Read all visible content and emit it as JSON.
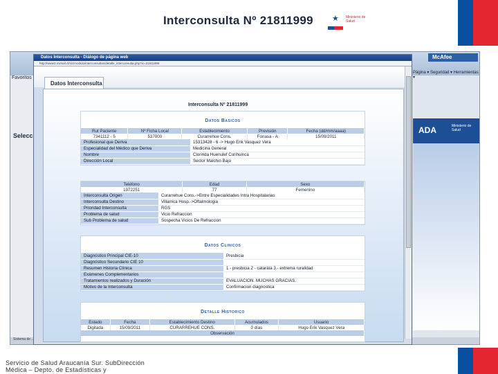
{
  "colors": {
    "flag_blue": "#0a4ea0",
    "flag_red": "#e3262f",
    "header_accent": "#2d5aa3",
    "label_cell": "#bfd2ea"
  },
  "background_window": {
    "toolbar_label": "Favoritos",
    "selector_label": "Selecc",
    "mcafee_label": "McAfee",
    "menu_label": "Página ▾  Seguridad ▾  Herramientas ▾",
    "banner_text": "ADA",
    "banner_sub": "Ministerio de Salud",
    "status_label": "Sistema de ..."
  },
  "dialog": {
    "title": "Datos Interconsulta - Diálogo de página web",
    "address": "http://www3.minsal.cl/sic/modulo/interconsultas/detalle_interconsulta.php?ic=21811999",
    "heading": "Interconsulta Nº 21811999",
    "logo_icon": "chile-government-star-icon",
    "logo_text": "Ministerio de Salud",
    "tab_label": "Datos Interconsulta",
    "form_title": "Interconsulta Nº 21811999"
  },
  "datos_basicos": {
    "title": "Datos Basicos",
    "headers": [
      "Rut Paciente",
      "Nº Ficha Local",
      "Establecimiento",
      "Previsión",
      "Fecha (dd/mm/aaaa)"
    ],
    "row": [
      "7341112 - 5",
      "537000",
      "Curarrehue Cons.",
      "Fonasa - A",
      "15/09/2011"
    ],
    "fields": [
      {
        "label": "Profesional que Deriva",
        "value": "15313428 - 6 -> Hugo Erik Vasquez Vera"
      },
      {
        "label": "Especialidad del Médico que Deriva",
        "value": "Medicina General"
      },
      {
        "label": "Nombre",
        "value": "Clorinda Huenulef Curihuinca"
      },
      {
        "label": "Dirección Local",
        "value": "Sector Malchin Bajo"
      }
    ]
  },
  "datos_paciente": {
    "headers": [
      "Teléfono",
      "Edad",
      "Sexo"
    ],
    "row": [
      "1972251",
      "77",
      "Femenino"
    ],
    "fields": [
      {
        "label": "Interconsulta Origen",
        "value": "Curarrehue Cons.->Entre Especialidades Intra Hospitalarias"
      },
      {
        "label": "Interconsulta Destino",
        "value": "Villarrica Hosp.->Oftalmologia"
      },
      {
        "label": "Prioridad Interconsulta",
        "value": "RGS"
      },
      {
        "label": "Problema de salud",
        "value": "Vicio Refraccion"
      },
      {
        "label": "Sub Problema de salud",
        "value": "Sospecha Vicios De Refraccion"
      }
    ]
  },
  "datos_clinicos": {
    "title": "Datos Clinicos",
    "fields": [
      {
        "label": "Diagnóstico Principal CIE-10",
        "value": "Presbicia"
      },
      {
        "label": "Diagnóstico Secundario CIE 10",
        "value": ""
      },
      {
        "label": "Resumen Historia Clínica",
        "value": "1 - presbicia 2 - catarata 3.- extrema ruralidad"
      },
      {
        "label": "Exámenes Complementarios",
        "value": ""
      },
      {
        "label": "Tratamientos realizados y Duración",
        "value": "EVALUACION. MUCHAS GRACIAS."
      },
      {
        "label": "Motivo de la Interconsulta",
        "value": "Confirmacion diagnostica"
      }
    ]
  },
  "detalle_historico": {
    "title": "Detalle Historico",
    "headers": [
      "Estado",
      "Fecha",
      "Establecimiento Destino",
      "Acumulados",
      "Usuario"
    ],
    "row": [
      "Digitada",
      "15/09/2011",
      "CURARREHUE CONS.",
      "0 días",
      "Hugo Erik Vasquez Vera"
    ],
    "observacion_label": "Observación"
  },
  "footer": {
    "line1": "Servicio de Salud Araucanía Sur. SubDirección",
    "line2": "Médica – Depto. de Estadísticas y"
  }
}
